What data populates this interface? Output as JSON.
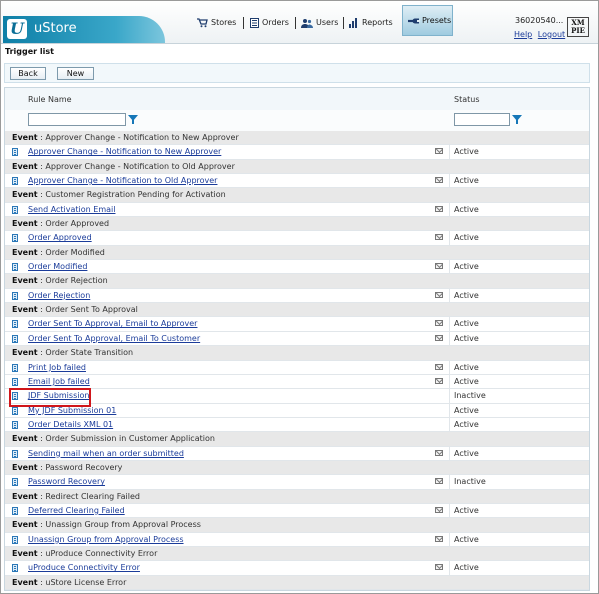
{
  "app": {
    "name": "uStore",
    "logo_letter": "U"
  },
  "nav": [
    {
      "label": "Stores",
      "icon": "cart-icon"
    },
    {
      "label": "Orders",
      "icon": "orders-icon"
    },
    {
      "label": "Users",
      "icon": "users-icon"
    },
    {
      "label": "Reports",
      "icon": "chart-icon"
    },
    {
      "label": "Presets",
      "icon": "wrench-icon",
      "active": true
    }
  ],
  "user": {
    "id": "36020540...",
    "help": "Help",
    "logout": "Logout"
  },
  "brand_logo": {
    "line1": "XM",
    "line2": "PIE"
  },
  "page": {
    "title": "Trigger list"
  },
  "toolbar": {
    "back_label": "Back",
    "new_label": "New"
  },
  "grid": {
    "col_rule_name": "Rule Name",
    "col_status": "Status",
    "event_prefix": "Event",
    "rows": [
      {
        "type": "event",
        "text": "Approver Change - Notification to New Approver"
      },
      {
        "type": "rule",
        "name": "Approver Change - Notification to New Approver",
        "mail": true,
        "status": "Active"
      },
      {
        "type": "event",
        "text": "Approver Change - Notification to Old Approver"
      },
      {
        "type": "rule",
        "name": "Approver Change - Notification to Old Approver",
        "mail": true,
        "status": "Active"
      },
      {
        "type": "event",
        "text": "Customer Registration Pending for Activation"
      },
      {
        "type": "rule",
        "name": "Send Activation Email",
        "mail": true,
        "status": "Active"
      },
      {
        "type": "event",
        "text": "Order Approved"
      },
      {
        "type": "rule",
        "name": "Order Approved",
        "mail": true,
        "status": "Active"
      },
      {
        "type": "event",
        "text": "Order Modified"
      },
      {
        "type": "rule",
        "name": "Order Modified",
        "mail": true,
        "status": "Active"
      },
      {
        "type": "event",
        "text": "Order Rejection"
      },
      {
        "type": "rule",
        "name": "Order Rejection",
        "mail": true,
        "status": "Active"
      },
      {
        "type": "event",
        "text": "Order Sent To Approval"
      },
      {
        "type": "rule",
        "name": "Order Sent To Approval, Email to Approver",
        "mail": true,
        "status": "Active"
      },
      {
        "type": "rule",
        "name": "Order Sent To Approval, Email To Customer",
        "mail": true,
        "status": "Active"
      },
      {
        "type": "event",
        "text": "Order State Transition"
      },
      {
        "type": "rule",
        "name": "Print Job failed",
        "mail": true,
        "status": "Active"
      },
      {
        "type": "rule",
        "name": "Email Job failed",
        "mail": true,
        "status": "Active"
      },
      {
        "type": "rule",
        "name": "JDF Submission",
        "mail": false,
        "status": "Inactive"
      },
      {
        "type": "rule",
        "name": "My JDF Submission 01",
        "mail": false,
        "status": "Active"
      },
      {
        "type": "rule",
        "name": "Order Details XML 01",
        "mail": false,
        "status": "Active"
      },
      {
        "type": "event",
        "text": "Order Submission in Customer Application"
      },
      {
        "type": "rule",
        "name": "Sending mail when an order submitted",
        "mail": true,
        "status": "Active"
      },
      {
        "type": "event",
        "text": "Password Recovery"
      },
      {
        "type": "rule",
        "name": "Password Recovery",
        "mail": true,
        "status": "Inactive"
      },
      {
        "type": "event",
        "text": "Redirect Clearing Failed"
      },
      {
        "type": "rule",
        "name": "Deferred Clearing Failed",
        "mail": true,
        "status": "Active"
      },
      {
        "type": "event",
        "text": "Unassign Group from Approval Process"
      },
      {
        "type": "rule",
        "name": "Unassign Group from Approval Process",
        "mail": true,
        "status": "Active"
      },
      {
        "type": "event",
        "text": "uProduce Connectivity Error"
      },
      {
        "type": "rule",
        "name": "uProduce Connectivity Error",
        "mail": true,
        "status": "Active"
      },
      {
        "type": "event",
        "text": "uStore License Error"
      }
    ]
  }
}
